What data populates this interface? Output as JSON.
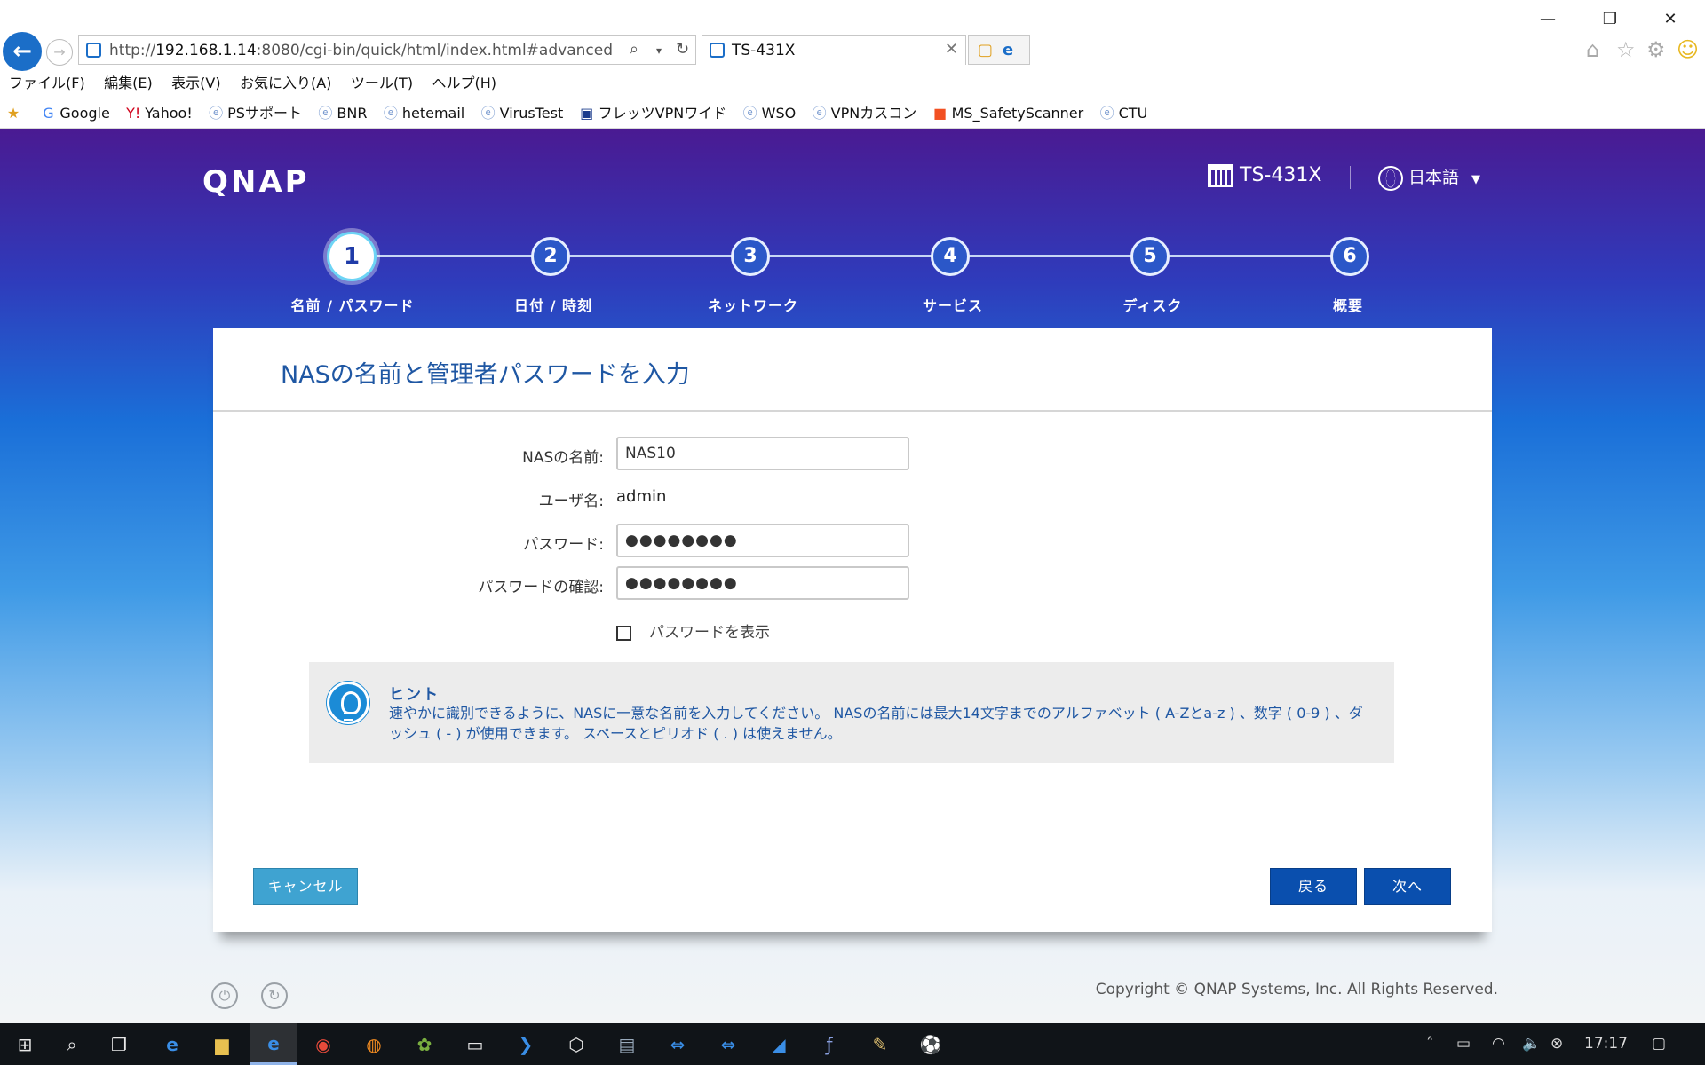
{
  "browser": {
    "url_prefix": "http://",
    "url_host": "192.168.1.14",
    "url_rest": ":8080/cgi-bin/quick/html/index.html#advanced",
    "tab_title": "TS-431X",
    "menu": [
      "ファイル(F)",
      "編集(E)",
      "表示(V)",
      "お気に入り(A)",
      "ツール(T)",
      "ヘルプ(H)"
    ],
    "favorites": [
      "Google",
      "Yahoo!",
      "PSサポート",
      "BNR",
      "hetemail",
      "VirusTest",
      "フレッツVPNワイド",
      "WSO",
      "VPNカスコン",
      "MS_SafetyScanner",
      "CTU"
    ]
  },
  "header": {
    "logo": "QNAP",
    "model": "TS-431X",
    "language": "日本語"
  },
  "steps": [
    {
      "num": "1",
      "label": "名前 / パスワード",
      "active": true
    },
    {
      "num": "2",
      "label": "日付 / 時刻",
      "active": false
    },
    {
      "num": "3",
      "label": "ネットワーク",
      "active": false
    },
    {
      "num": "4",
      "label": "サービス",
      "active": false
    },
    {
      "num": "5",
      "label": "ディスク",
      "active": false
    },
    {
      "num": "6",
      "label": "概要",
      "active": false
    }
  ],
  "form": {
    "title": "NASの名前と管理者パスワードを入力",
    "nas_name_label": "NASの名前:",
    "nas_name_value": "NAS10",
    "user_label": "ユーザ名:",
    "user_value": "admin",
    "password_label": "パスワード:",
    "password_value": "●●●●●●●●",
    "confirm_label": "パスワードの確認:",
    "confirm_value": "●●●●●●●●",
    "show_password_label": "パスワードを表示",
    "show_password_checked": false
  },
  "hint": {
    "title": "ヒント",
    "text": "速やかに識別できるように、NASに一意な名前を入力してください。 NASの名前には最大14文字までのアルファベット ( A-Zとa-z ) 、数字 ( 0-9 ) 、ダッシュ ( - ) が使用できます。 スペースとピリオド ( . ) は使えません。"
  },
  "buttons": {
    "cancel": "キャンセル",
    "back": "戻る",
    "next": "次へ"
  },
  "footer": {
    "copyright": "Copyright © QNAP Systems, Inc. All Rights Reserved."
  },
  "taskbar": {
    "time": "17:17"
  },
  "colors": {
    "accent": "#1f57a3",
    "primary_button": "#0a4fae",
    "cancel_button": "#3fa3d1"
  }
}
